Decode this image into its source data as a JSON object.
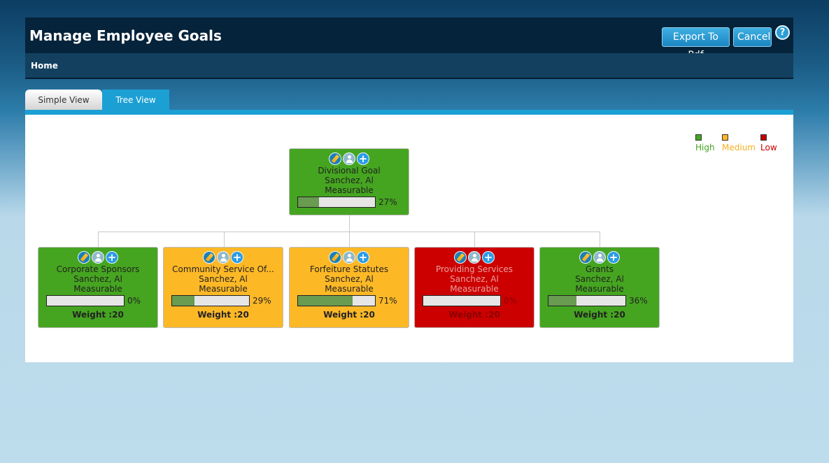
{
  "header": {
    "title": "Manage Employee Goals",
    "export_label": "Export To Pdf",
    "cancel_label": "Cancel",
    "help_label": "?"
  },
  "nav": {
    "home": "Home"
  },
  "tabs": [
    {
      "label": "Simple View",
      "active": false
    },
    {
      "label": "Tree View",
      "active": true
    }
  ],
  "legend": [
    {
      "label": "High",
      "color": "#43a521"
    },
    {
      "label": "Medium",
      "color": "#f5b020"
    },
    {
      "label": "Low",
      "color": "#c00000"
    }
  ],
  "root": {
    "name": "Divisional Goal",
    "owner": "Sanchez, Al",
    "type": "Measurable",
    "progress_label": "27%",
    "progress": 0.27,
    "status": "High"
  },
  "children": [
    {
      "name": "Corporate Sponsors",
      "owner": "Sanchez, Al",
      "type": "Measurable",
      "progress_label": "0%",
      "progress": 0.0,
      "weight": "Weight :20",
      "status": "High"
    },
    {
      "name": "Community Service Of...",
      "owner": "Sanchez, Al",
      "type": "Measurable",
      "progress_label": "29%",
      "progress": 0.29,
      "weight": "Weight :20",
      "status": "Medium"
    },
    {
      "name": "Forfeiture Statutes",
      "owner": "Sanchez, Al",
      "type": "Measurable",
      "progress_label": "71%",
      "progress": 0.71,
      "weight": "Weight :20",
      "status": "Medium"
    },
    {
      "name": "Providing Services",
      "owner": "Sanchez, Al",
      "type": "Measurable",
      "progress_label": "0%",
      "progress": 0.0,
      "weight": "Weight :20",
      "status": "Low"
    },
    {
      "name": "Grants",
      "owner": "Sanchez, Al",
      "type": "Measurable",
      "progress_label": "36%",
      "progress": 0.36,
      "weight": "Weight :20",
      "status": "High"
    }
  ],
  "icons": [
    "edit-icon",
    "user-icon",
    "add-icon"
  ]
}
